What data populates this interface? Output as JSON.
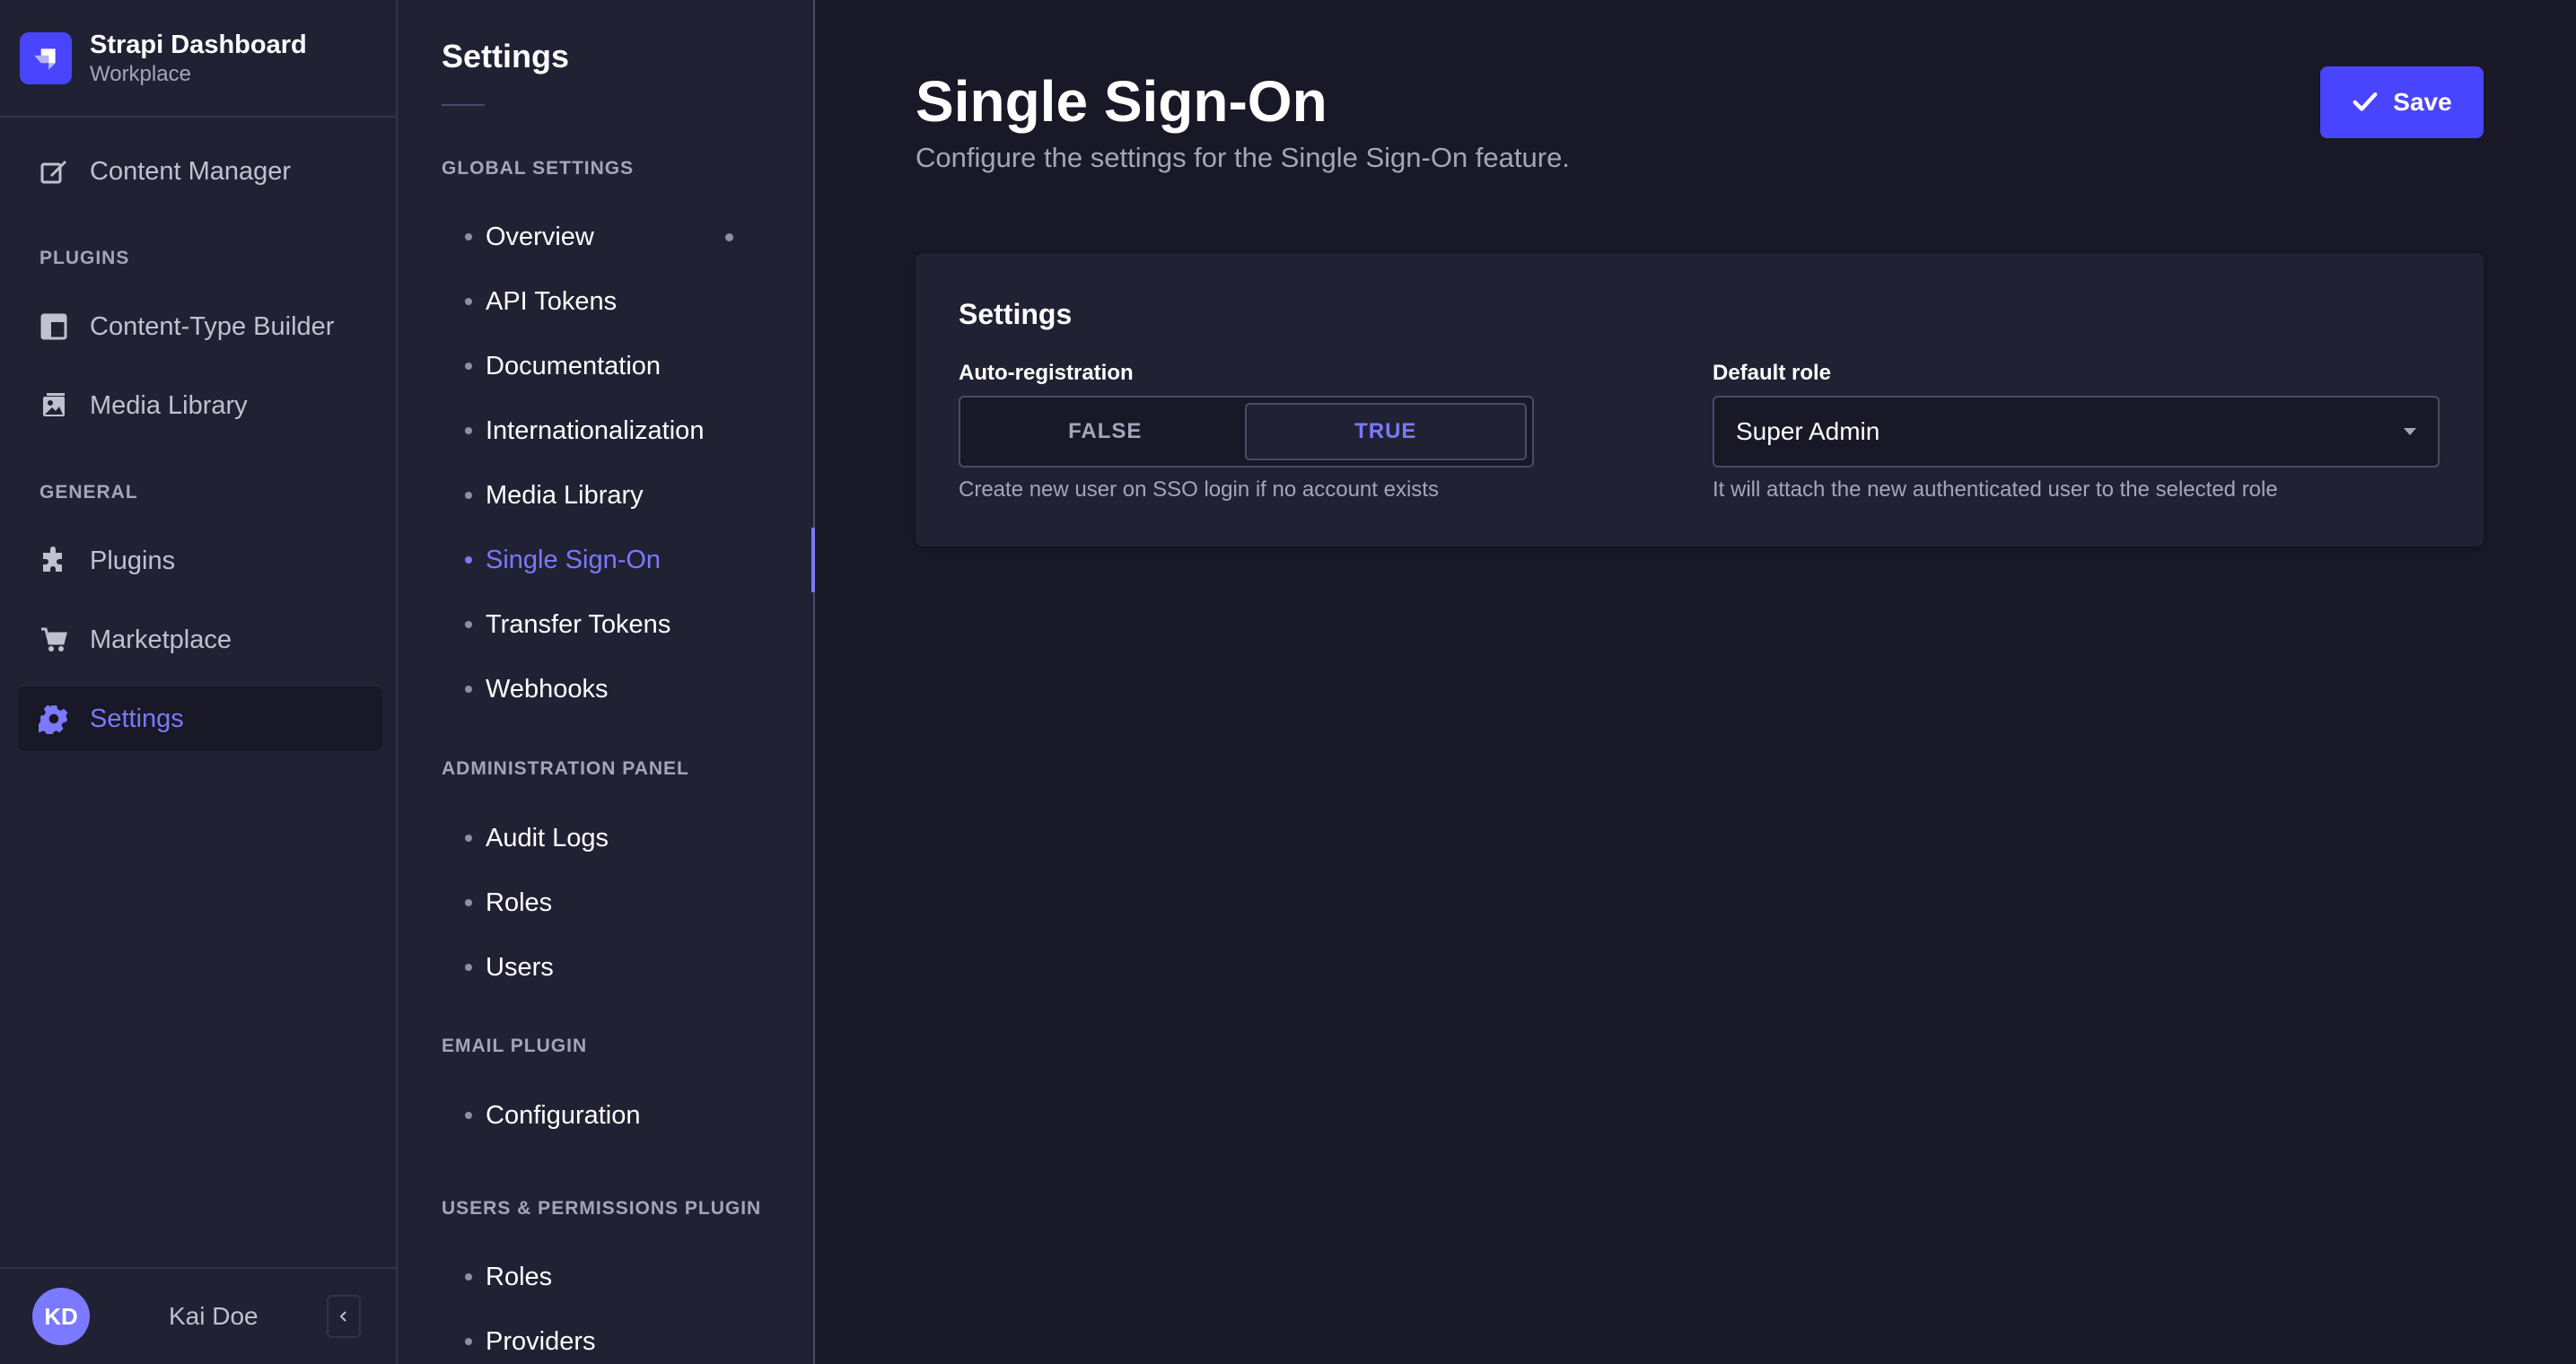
{
  "brand": {
    "title": "Strapi Dashboard",
    "subtitle": "Workplace"
  },
  "mainnav": {
    "content_manager": "Content Manager",
    "plugins_section": "PLUGINS",
    "content_type_builder": "Content-Type Builder",
    "media_library": "Media Library",
    "general_section": "GENERAL",
    "plugins": "Plugins",
    "marketplace": "Marketplace",
    "settings": "Settings"
  },
  "user": {
    "initials": "KD",
    "name": "Kai Doe"
  },
  "subnav": {
    "title": "Settings",
    "global_section": "GLOBAL SETTINGS",
    "global_items": [
      "Overview",
      "API Tokens",
      "Documentation",
      "Internationalization",
      "Media Library",
      "Single Sign-On",
      "Transfer Tokens",
      "Webhooks"
    ],
    "admin_section": "ADMINISTRATION PANEL",
    "admin_items": [
      "Audit Logs",
      "Roles",
      "Users"
    ],
    "email_section": "EMAIL PLUGIN",
    "email_items": [
      "Configuration"
    ],
    "up_section": "USERS & PERMISSIONS PLUGIN",
    "up_items": [
      "Roles",
      "Providers"
    ],
    "active_item": "Single Sign-On"
  },
  "page": {
    "title": "Single Sign-On",
    "subtitle": "Configure the settings for the Single Sign-On feature.",
    "save_label": "Save"
  },
  "card": {
    "title": "Settings",
    "auto_registration": {
      "label": "Auto-registration",
      "false_label": "FALSE",
      "true_label": "TRUE",
      "selected": "TRUE",
      "hint": "Create new user on SSO login if no account exists"
    },
    "default_role": {
      "label": "Default role",
      "value": "Super Admin",
      "hint": "It will attach the new authenticated user to the selected role"
    }
  },
  "colors": {
    "accent": "#7b79ff",
    "primary": "#4945ff",
    "background": "#181826",
    "panel": "#212134"
  }
}
